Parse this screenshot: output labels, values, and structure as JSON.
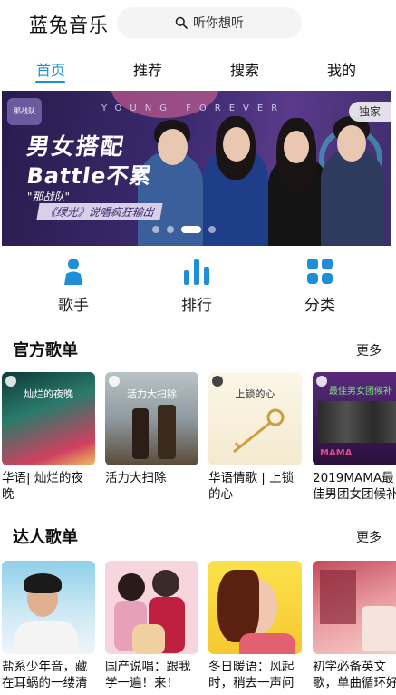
{
  "app": {
    "title": "蓝兔音乐"
  },
  "search": {
    "placeholder": "听你想听"
  },
  "tabs": [
    {
      "label": "首页",
      "active": true
    },
    {
      "label": "推荐"
    },
    {
      "label": "搜索"
    },
    {
      "label": "我的"
    }
  ],
  "banner": {
    "top_text": "YOUNG FOREVER",
    "title_line1": "男女搭配",
    "title_line2": "Battle不累",
    "tag1": "\"那战队\"",
    "tag2": "《绿光》说唱疯狂输出",
    "exclusive": "独家",
    "logo_text": "那战队",
    "slide_count": 4,
    "active_slide": 2
  },
  "categories": [
    {
      "label": "歌手",
      "icon": "singer-icon"
    },
    {
      "label": "排行",
      "icon": "ranking-icon"
    },
    {
      "label": "分类",
      "icon": "category-icon"
    }
  ],
  "official": {
    "title": "官方歌单",
    "more": "更多",
    "items": [
      {
        "title": "华语| 灿烂的夜晚",
        "cover_text": "灿烂的夜晚"
      },
      {
        "title": "活力大扫除",
        "cover_text": "活力大扫除"
      },
      {
        "title": "华语情歌 | 上锁的心",
        "cover_text": "上锁的心"
      },
      {
        "title": "2019MAMA最佳男团女团候补",
        "cover_text": "最佳男女团候补"
      }
    ]
  },
  "talent": {
    "title": "达人歌单",
    "more": "更多",
    "items": [
      {
        "title": "盐系少年音，藏在耳蜗的一缕清新"
      },
      {
        "title": "国产说唱：跟我学一遍！来！"
      },
      {
        "title": "冬日暖语：风起时，稍去一声问候"
      },
      {
        "title": "初学必备英文歌，单曲循环好听"
      }
    ]
  },
  "colors": {
    "accent": "#1f8ed8"
  }
}
